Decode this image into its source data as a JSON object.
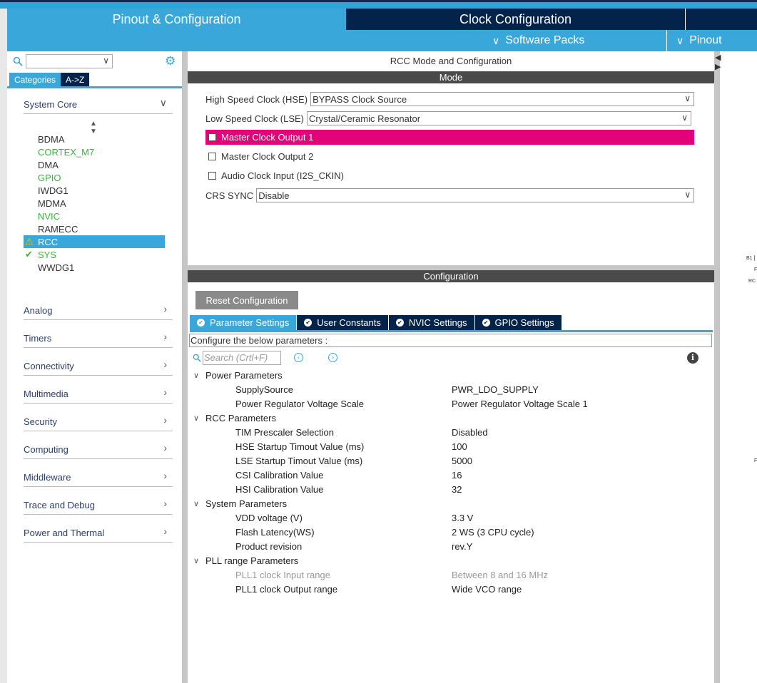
{
  "top_tabs": {
    "pinout_config": "Pinout & Configuration",
    "clock_config": "Clock Configuration"
  },
  "subbar": {
    "software_packs": "Software Packs",
    "pinout": "Pinout"
  },
  "left": {
    "category_tabs": [
      "Categories",
      "A->Z"
    ],
    "system_core": "System Core",
    "ip_items": [
      {
        "label": "BDMA",
        "state": "normal"
      },
      {
        "label": "CORTEX_M7",
        "state": "green"
      },
      {
        "label": "DMA",
        "state": "normal"
      },
      {
        "label": "GPIO",
        "state": "green"
      },
      {
        "label": "IWDG1",
        "state": "normal"
      },
      {
        "label": "MDMA",
        "state": "normal"
      },
      {
        "label": "NVIC",
        "state": "green"
      },
      {
        "label": "RAMECC",
        "state": "normal"
      },
      {
        "label": "RCC",
        "state": "selected-warning"
      },
      {
        "label": "SYS",
        "state": "green-check"
      },
      {
        "label": "WWDG1",
        "state": "normal"
      }
    ],
    "sections": [
      "Analog",
      "Timers",
      "Connectivity",
      "Multimedia",
      "Security",
      "Computing",
      "Middleware",
      "Trace and Debug",
      "Power and Thermal"
    ]
  },
  "main": {
    "title": "RCC Mode and Configuration",
    "mode_bar": "Mode",
    "hse_label": "High Speed Clock (HSE)",
    "hse_value": "BYPASS Clock Source",
    "lse_label": "Low Speed Clock (LSE)",
    "lse_value": "Crystal/Ceramic Resonator",
    "checkboxes": [
      "Master Clock Output 1",
      "Master Clock Output 2",
      "Audio Clock Input (I2S_CKIN)"
    ],
    "crs_label": "CRS SYNC",
    "crs_value": "Disable",
    "config_bar": "Configuration",
    "reset_button": "Reset Configuration",
    "param_tabs": [
      "Parameter Settings",
      "User Constants",
      "NVIC Settings",
      "GPIO Settings"
    ],
    "configure_text": "Configure the below parameters :",
    "search_placeholder": "Search (Crtl+F)",
    "groups": [
      {
        "name": "Power Parameters",
        "params": [
          {
            "name": "SupplySource",
            "value": "PWR_LDO_SUPPLY"
          },
          {
            "name": "Power Regulator Voltage Scale",
            "value": "Power Regulator Voltage Scale 1"
          }
        ]
      },
      {
        "name": "RCC Parameters",
        "params": [
          {
            "name": "TIM Prescaler Selection",
            "value": "Disabled"
          },
          {
            "name": "HSE Startup Timout Value (ms)",
            "value": "100"
          },
          {
            "name": "LSE Startup Timout Value (ms)",
            "value": "5000"
          },
          {
            "name": "CSI Calibration Value",
            "value": "16"
          },
          {
            "name": "HSI Calibration Value",
            "value": "32"
          }
        ]
      },
      {
        "name": "System Parameters",
        "params": [
          {
            "name": "VDD voltage (V)",
            "value": "3.3 V"
          },
          {
            "name": "Flash Latency(WS)",
            "value": "2 WS (3 CPU cycle)"
          },
          {
            "name": "Product revision",
            "value": "rev.Y"
          }
        ]
      },
      {
        "name": "PLL range Parameters",
        "params": [
          {
            "name": "PLL1 clock Input range",
            "value": "Between 8 and 16 MHz",
            "disabled": true
          },
          {
            "name": "PLL1 clock Output range",
            "value": "Wide VCO range"
          }
        ]
      }
    ]
  },
  "right_fragments": [
    "B1 [",
    "F",
    "RC",
    "F"
  ],
  "colors": {
    "accent": "#3aa7db",
    "navy": "#03234b",
    "highlight": "#e2027a",
    "green": "#3bb33b",
    "warning": "#f5c400"
  }
}
